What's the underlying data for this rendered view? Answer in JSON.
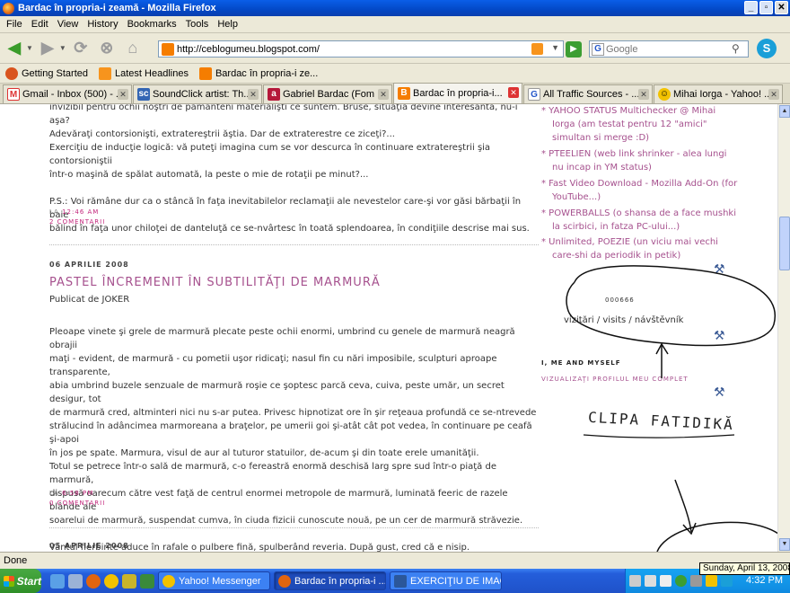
{
  "window": {
    "title": "Bardac în propria-i zeamă - Mozilla Firefox"
  },
  "menu": [
    "File",
    "Edit",
    "View",
    "History",
    "Bookmarks",
    "Tools",
    "Help"
  ],
  "nav": {
    "url": "http://ceblogumeu.blogspot.com/",
    "search_placeholder": "Google"
  },
  "bookmarks": [
    {
      "label": "Getting Started",
      "icon": "firefox-icon",
      "color": "#d9541e"
    },
    {
      "label": "Latest Headlines",
      "icon": "rss-icon",
      "color": "#f7941d"
    },
    {
      "label": "Bardac în propria-i ze...",
      "icon": "blogger-icon",
      "color": "#f57d00"
    }
  ],
  "tabs": [
    {
      "label": "Gmail - Inbox (500) - ...",
      "icon": "gmail-icon",
      "color": "#d33"
    },
    {
      "label": "SoundClick artist: Th...",
      "icon": "soundclick-icon",
      "color": "#3466b4"
    },
    {
      "label": "Gabriel Bardac (Fom ...",
      "icon": "profile-icon",
      "color": "#b5183a"
    },
    {
      "label": "Bardac în propria-i...",
      "icon": "blogger-icon",
      "color": "#f57d00",
      "active": true
    },
    {
      "label": "All Traffic Sources - ...",
      "icon": "google-icon",
      "color": "#2356c9"
    },
    {
      "label": "Mihai Iorga - Yahoo! ...",
      "icon": "yahoo-smiley-icon",
      "color": "#f2c200"
    }
  ],
  "post1": {
    "lines": [
      "invizibil pentru ochii noştri de pământeni materialişti ce suntem. Bruse, situaţia devine interesantă, nu-i aşa?",
      "Adevăraţi contorsionişti, extratereştrii ăştia. Dar de extraterestre ce ziceţi?...",
      "Exerciţiu de inducţie logică: vă puteţi imagina cum se vor descurca în continuare extratereştrii şia contorsioniştii",
      "într-o maşină de spălat automată, la peste o mie de rotaţii pe minut?...",
      "",
      "P.S.: Voi rămâne dur ca o stâncă în faţa inevitabilelor reclamaţii ale nevestelor care-şi vor găsi bărbaţii în baie",
      "bălind în faţa unor chiloţei de danteluţă ce se-nvârtesc în toată splendoarea, în condiţiile descrise mai sus."
    ],
    "at_label": "LA",
    "time": "12:46 AM",
    "comments": "2 COMENTARII"
  },
  "post2": {
    "date": "06 APRILIE 2008",
    "title": "PASTEL ÎNCREMENIT ÎN SUBTILITĂŢI DE MARMURĂ",
    "byline": "Publicat de JOKER",
    "lines": [
      "Pleoape vinete şi grele de marmură plecate peste ochii enormi, umbrind cu genele de marmură neagră obrajii",
      "maţi - evident, de marmură - cu pometii uşor ridicaţi; nasul fin cu nări imposibile, sculpturi aproape transparente,",
      "abia umbrind buzele senzuale de marmură roşie ce şoptesc parcă ceva, cuiva, peste umăr, un secret desigur, tot",
      "de marmură cred, altminteri nici nu s-ar putea. Privesc hipnotizat ore în şir reţeaua profundă ce se-ntrevede",
      "strălucind în adâncimea marmoreana a braţelor, pe umerii goi şi-atât cât pot vedea, în continuare pe ceafă şi-apoi",
      "în jos pe spate. Marmura, visul de aur al tuturor statuilor, de-acum şi din toate erele umanităţii.",
      "Totul se petrece într-o sală de marmură, c-o fereastră enormă deschisă larg spre sud într-o piaţă de marmură,",
      "dispusă oarecum către vest faţă de centrul enormei metropole de marmură, luminată feeric de razele blânde ale",
      "soarelui de marmură, suspendat cumva, în ciuda fizicii cunoscute nouă, pe un cer de marmură străvezie.",
      "",
      "Vântul fierbinte aduce în rafale o pulbere fină, spulberând reveria. După gust, cred că e nisip."
    ],
    "at_label": "LA",
    "time": "6:58 PM",
    "comments": "0 COMENTARII"
  },
  "post3": {
    "date": "05 APRILIE 2008"
  },
  "sidebar": {
    "links": [
      [
        "* YAHOO STATUS Multichecker @ Mihai",
        "Iorga (am testat pentru 12 \"amici\"",
        "simultan si merge :D)"
      ],
      [
        "* PTEELIEN (web link shrinker - alea lungi",
        "nu incap in YM status)"
      ],
      [
        "* Fast Video Download - Mozilla Add-On (for",
        "YouTube...)"
      ],
      [
        "* POWERBALLS (o shansa de a face mushki",
        "la scirbici, in fatza PC-ului...)"
      ],
      [
        "* Unlimited, POEZIE (un viciu mai vechi",
        "care-shi da periodik in petik)"
      ]
    ],
    "counter": "000666",
    "visits": "vizitări / visits / návštěvník",
    "profile_heading": "I, ME AND MYSELF",
    "profile_link": "VIZUALIZAŢI PROFILUL MEU COMPLET"
  },
  "annotation_text": "CLIPA FATIDIKĂ",
  "status": "Done",
  "taskbar": {
    "start": "Start",
    "tasks": [
      {
        "label": "Yahoo! Messenger",
        "color": "#7b0099"
      },
      {
        "label": "Bardac în propria-i ...",
        "color": "#e2650f",
        "active": true
      },
      {
        "label": "EXERCIŢIU DE IMAGI...",
        "color": "#2b579a"
      }
    ],
    "clock": "4:32 PM",
    "tooltip": "Sunday, April 13, 2008"
  }
}
